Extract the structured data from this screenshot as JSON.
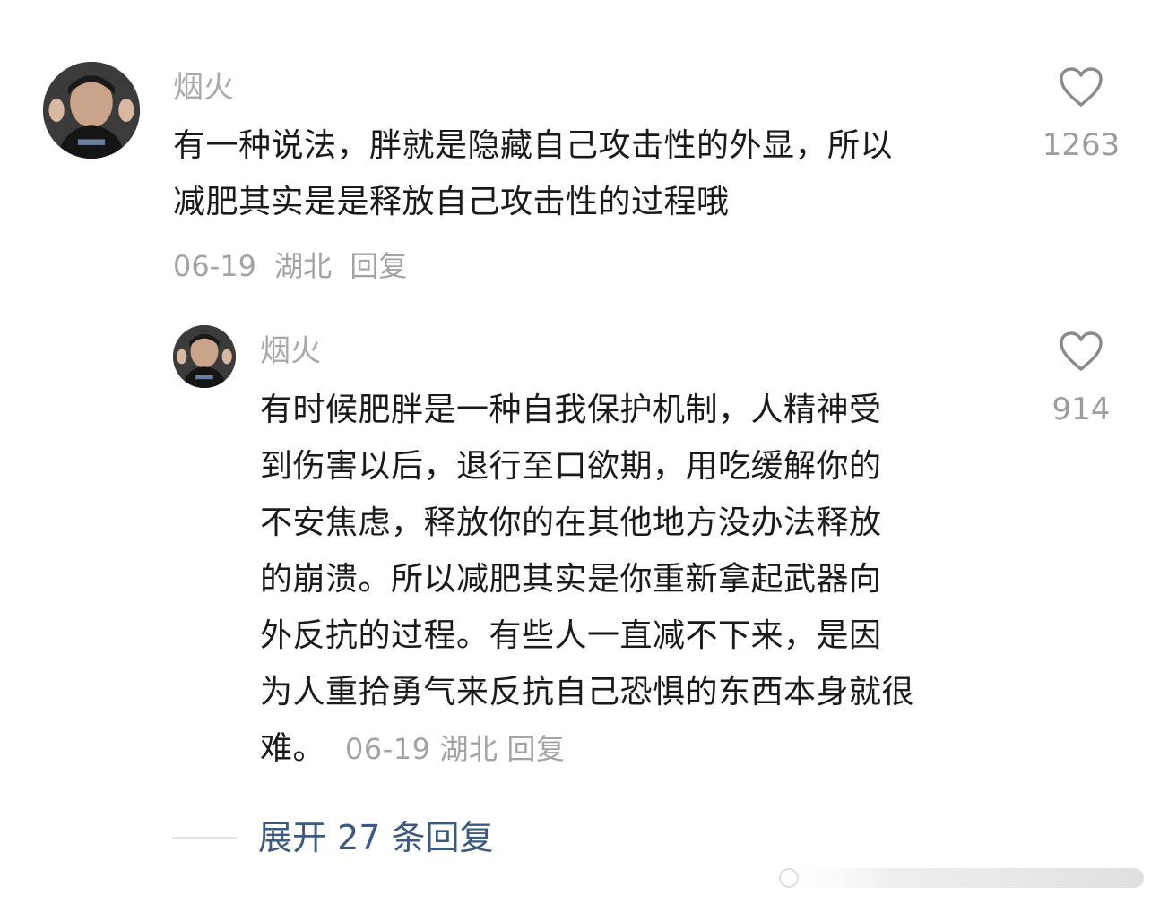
{
  "comment": {
    "username": "烟火",
    "lines": [
      "有一种说法，胖就是隐藏自己攻击性的外显，所以",
      "减肥其实是是释放自己攻击性的过程哦"
    ],
    "date": "06-19",
    "location": "湖北",
    "reply_label": "回复",
    "like_count": "1263"
  },
  "reply": {
    "username": "烟火",
    "lines": [
      "有时候肥胖是一种自我保护机制，人精神受",
      "到伤害以后，退行至口欲期，用吃缓解你的",
      "不安焦虑，释放你的在其他地方没办法释放",
      "的崩溃。所以减肥其实是你重新拿起武器向",
      "外反抗的过程。有些人一直减不下来，是因",
      "为人重拾勇气来反抗自己恐惧的东西本身就很"
    ],
    "last_line": "难。",
    "date": "06-19",
    "location": "湖北",
    "reply_label": "回复",
    "like_count": "914"
  },
  "expand_label": "展开 27 条回复",
  "icons": {
    "like": "heart-outline-icon",
    "avatar": "user-avatar"
  },
  "colors": {
    "link": "#3c5a80",
    "meta": "#a3a3a3"
  }
}
